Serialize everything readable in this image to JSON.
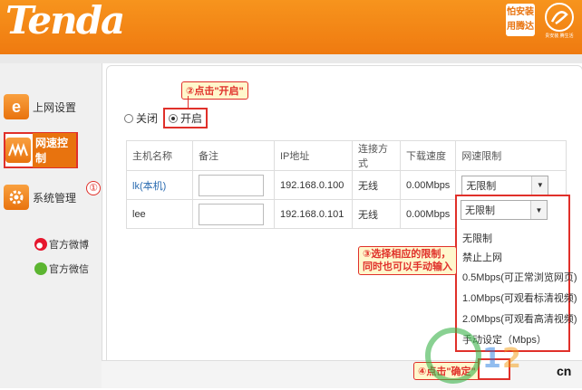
{
  "header": {
    "logo": "Tenda",
    "badge_line1": "怕安装",
    "badge_line2": "用腾达",
    "brand_sub": "贵安装 腾生活"
  },
  "sidebar": {
    "items": [
      {
        "label": "上网设置",
        "icon": "internet-e-icon"
      },
      {
        "label": "网速控制",
        "icon": "speed-wave-icon"
      },
      {
        "label": "系统管理",
        "icon": "gear-icon"
      }
    ],
    "social": [
      {
        "label": "官方微博",
        "icon": "weibo-icon"
      },
      {
        "label": "官方微信",
        "icon": "wechat-icon"
      }
    ]
  },
  "speed_control": {
    "off_label": "关闭",
    "on_label": "开启",
    "selected": "开启"
  },
  "table": {
    "headers": [
      "主机名称",
      "备注",
      "IP地址",
      "连接方式",
      "下载速度",
      "网速限制"
    ],
    "rows": [
      {
        "host": "lk(本机)",
        "remark": "",
        "ip": "192.168.0.100",
        "conn": "无线",
        "speed": "0.00Mbps",
        "limit": "无限制"
      },
      {
        "host": "lee",
        "remark": "",
        "ip": "192.168.0.101",
        "conn": "无线",
        "speed": "0.00Mbps",
        "limit": "无限制"
      }
    ]
  },
  "dropdown": {
    "selected": "无限制",
    "options": [
      "无限制",
      "禁止上网",
      "0.5Mbps(可正常浏览网页)",
      "1.0Mbps(可观看标清视频)",
      "2.0Mbps(可观看高清视频)",
      "手动设定（Mbps）"
    ]
  },
  "callouts": {
    "step1": "①",
    "step2": "②点击\"开启\"",
    "step3_line1": "③选择相应的限制，",
    "step3_line2": "同时也可以手动输入",
    "step4": "④点击\"确定\""
  },
  "watermark": {
    "text": "cn"
  },
  "colors": {
    "brand": "#ef7a10",
    "annotation": "#e0302a",
    "link": "#2a6bb0"
  }
}
